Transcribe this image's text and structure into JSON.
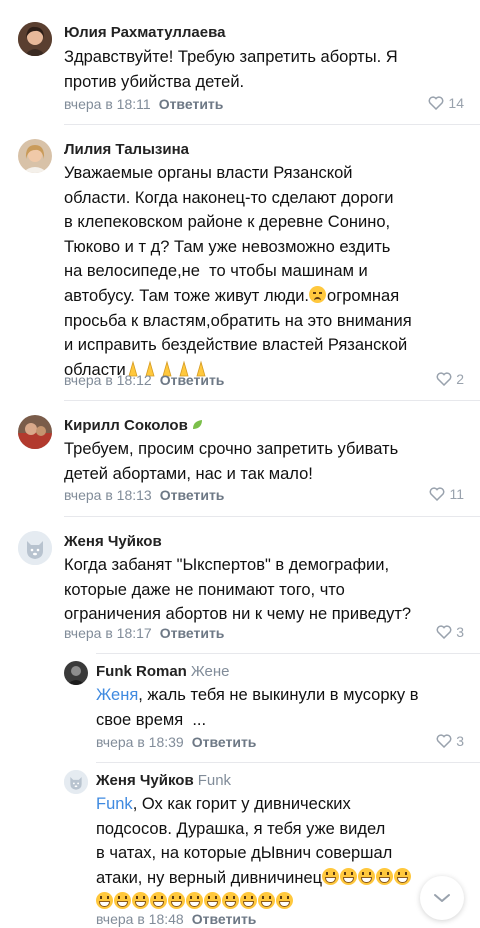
{
  "comments": [
    {
      "author": "Юлия Рахматуллаева",
      "lines": [
        "Здравствуйте! Требую запретить аборты. Я",
        "против убийства детей."
      ],
      "time": "вчера в 18:11",
      "reply_label": "Ответить",
      "likes": "14"
    },
    {
      "author": "Лилия Талызина",
      "lines": [
        "Уважаемые органы власти Рязанской",
        "области. Когда наконец-то сделают дороги",
        "в клепековском районе к деревне Сонино,",
        "Тюково и т д? Там уже невозможно ездить",
        "на велосипеде,не  то чтобы машинам и",
        "автобусу. Там тоже живут люди.",
        "просьба к властям,обратить на это внимания",
        "и исправить бездействие властей Рязанской",
        "области"
      ],
      "line6_suffix": "огромная",
      "time": "вчера в 18:12",
      "reply_label": "Ответить",
      "likes": "2"
    },
    {
      "author": "Кирилл Соколов",
      "lines": [
        "Требуем, просим срочно запретить убивать",
        "детей абортами, нас и так мало!"
      ],
      "time": "вчера в 18:13",
      "reply_label": "Ответить",
      "likes": "11"
    },
    {
      "author": "Женя Чуйков",
      "lines": [
        "Когда забанят \"Ыкспертов\" в демографии,",
        "которые даже не понимают того, что",
        "ограничения абортов ни к чему не приведут?"
      ],
      "time": "вчера в 18:17",
      "reply_label": "Ответить",
      "likes": "3"
    }
  ],
  "replies": [
    {
      "author": "Funk Roman",
      "reply_to": "Жене",
      "mention": "Женя",
      "lines": [
        ", жаль тебя не выкинули в мусорку в",
        "свое время  ..."
      ],
      "time": "вчера в 18:39",
      "reply_label": "Ответить",
      "likes": "3"
    },
    {
      "author": "Женя Чуйков",
      "reply_to": "Funk",
      "mention": "Funk",
      "lines": [
        ", Ох как горит у дивнических",
        "подсосов. Дурашка, я тебя уже видел",
        "в чатах, на которые дЫвнич совершал",
        "атаки, ну верный дивничинец"
      ],
      "time": "вчера в 18:48",
      "reply_label": "Ответить",
      "likes": ""
    }
  ],
  "colors": {
    "accent": "#3f8ae0",
    "meta": "#818c99",
    "divider": "#e7e8ec"
  },
  "icons": [
    "heart-icon",
    "chevron-down-icon",
    "leaf-badge-icon",
    "dog-avatar-icon"
  ]
}
